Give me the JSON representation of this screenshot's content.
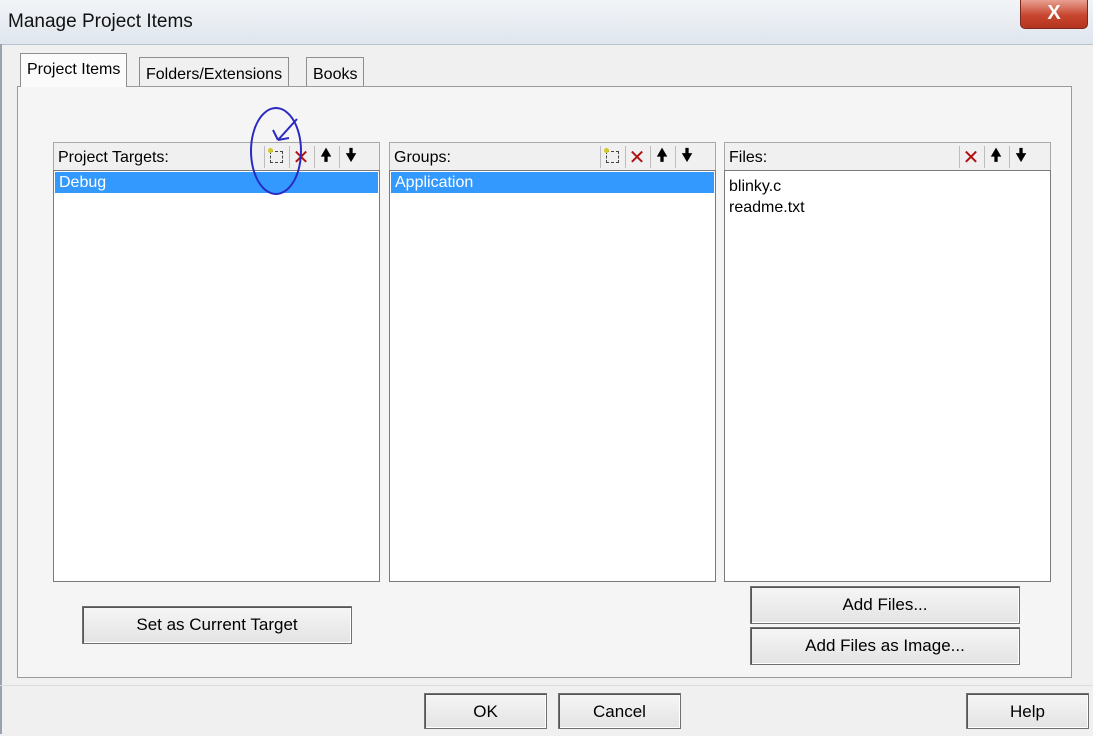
{
  "window": {
    "title": "Manage Project Items",
    "close_glyph": "X"
  },
  "tabs": [
    {
      "label": "Project Items",
      "active": true
    },
    {
      "label": "Folders/Extensions",
      "active": false
    },
    {
      "label": "Books",
      "active": false
    }
  ],
  "targets": {
    "label": "Project Targets:",
    "items": [
      "Debug"
    ],
    "selected": "Debug",
    "toolbar": [
      "new-icon",
      "delete-icon",
      "move-up-icon",
      "move-down-icon"
    ]
  },
  "groups": {
    "label": "Groups:",
    "items": [
      "Application"
    ],
    "selected": "Application",
    "toolbar": [
      "new-icon",
      "delete-icon",
      "move-up-icon",
      "move-down-icon"
    ]
  },
  "files": {
    "label": "Files:",
    "items": [
      "blinky.c",
      "readme.txt"
    ],
    "toolbar": [
      "delete-icon",
      "move-up-icon",
      "move-down-icon"
    ]
  },
  "buttons": {
    "set_current_target": "Set as Current Target",
    "add_files": "Add Files...",
    "add_files_as_image": "Add Files as Image...",
    "ok": "OK",
    "cancel": "Cancel",
    "help": "Help"
  },
  "colors": {
    "selection": "#3399ff",
    "annotation": "#2a2ac2",
    "delete_icon": "#b01010"
  }
}
